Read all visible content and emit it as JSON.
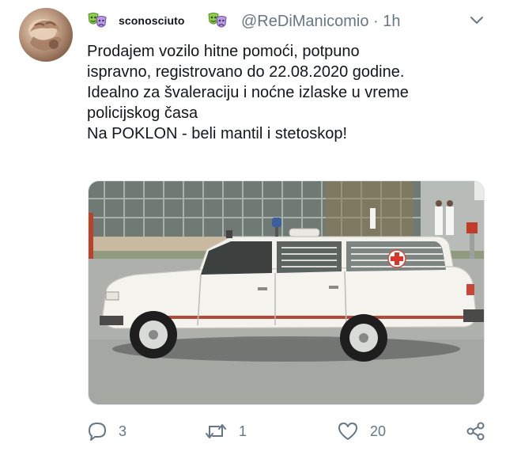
{
  "tweet": {
    "display_name": "sconosciuto",
    "handle_line": "@ReDiManicomio · 1h",
    "text_lines": [
      "Prodajem vozilo hitne pomoći, potpuno",
      "ispravno, registrovano do 22.08.2020 godine.",
      "Idealno za švaleraciju i noćne izlaske u vreme",
      "policijskog časa",
      "Na POKLON - beli mantil i stetoskop!"
    ],
    "media_icon": "ambulance-car-photo",
    "replies": "3",
    "retweets": "1",
    "likes": "20"
  },
  "icons": {
    "avatar": "avatar-photo",
    "emoji": "theater-masks-icon",
    "more": "chevron-down-icon",
    "reply": "reply-icon",
    "retweet": "retweet-icon",
    "like": "heart-icon",
    "share": "share-icon"
  },
  "colors": {
    "text": "#14171a",
    "muted": "#657786",
    "emoji_green": "#8fd14f",
    "emoji_purple": "#b99be0"
  }
}
